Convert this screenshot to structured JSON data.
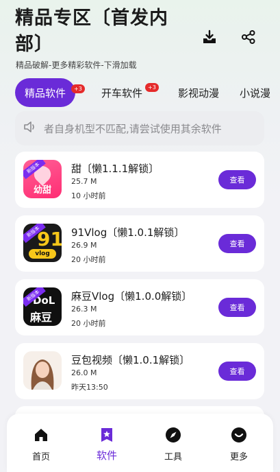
{
  "header": {
    "title": "精品专区〔首发内部〕",
    "subtitle": "精品破解-更多精彩软件-下滑加载",
    "download_icon": "download-tray-icon",
    "share_icon": "share-icon"
  },
  "tabs": [
    {
      "label": "精品软件",
      "badge": "+3",
      "active": true
    },
    {
      "label": "开车软件",
      "badge": "+3",
      "active": false
    },
    {
      "label": "影视动漫",
      "active": false
    },
    {
      "label": "小说漫",
      "active": false
    }
  ],
  "notice": {
    "icon": "speaker-icon",
    "text": "者自身机型不匹配,请尝试使用其余软件"
  },
  "apps": [
    {
      "name": "甜〔懒1.1.1解锁〕",
      "size": "25.7 M",
      "time": "10 小时前",
      "button": "查看",
      "icon_text": "幼甜",
      "ribbon": "新版本"
    },
    {
      "name": "91Vlog〔懒1.0.1解锁〕",
      "size": "26.9 M",
      "time": "20 小时前",
      "button": "查看",
      "icon_text": "vlog",
      "icon_big": "91",
      "ribbon": "新版本"
    },
    {
      "name": "麻豆Vlog〔懒1.0.0解锁〕",
      "size": "26.3 M",
      "time": "20 小时前",
      "button": "查看",
      "icon_text": "DoL",
      "icon_sub": "麻豆",
      "ribbon": "新版本"
    },
    {
      "name": "豆包视频〔懒1.0.1解锁〕",
      "size": "26.0 M",
      "time": "昨天13:50",
      "button": "查看"
    }
  ],
  "bottom_nav": [
    {
      "label": "首页",
      "icon": "home-icon",
      "active": false
    },
    {
      "label": "软件",
      "icon": "star-bookmark-icon",
      "active": true
    },
    {
      "label": "工具",
      "icon": "compass-icon",
      "active": false
    },
    {
      "label": "更多",
      "icon": "smile-icon",
      "active": false
    }
  ],
  "colors": {
    "accent": "#6a2bd8",
    "badge": "#e52b2b",
    "card": "#ffffff",
    "notice_bg": "#ecedf0"
  }
}
